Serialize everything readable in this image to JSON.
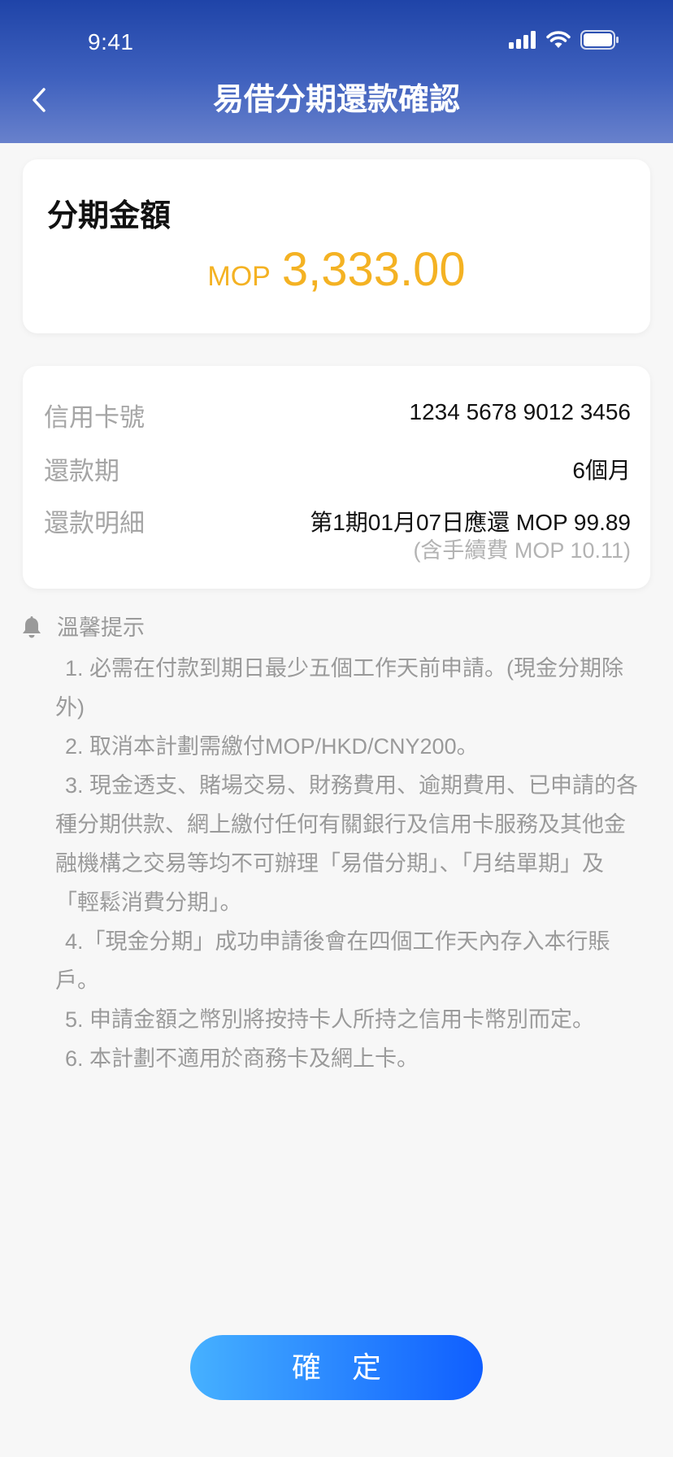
{
  "status_bar": {
    "time": "9:41"
  },
  "header": {
    "title": "易借分期還款確認"
  },
  "amount": {
    "label": "分期金額",
    "currency": "MOP",
    "value": "3,333.00"
  },
  "details": [
    {
      "label": "信用卡號",
      "value": "1234 5678 9012 3456"
    },
    {
      "label": "還款期",
      "value": "6個月"
    },
    {
      "label": "還款明細",
      "value": "第1期01月07日應還 MOP 99.89",
      "sub": "(含手續費 MOP 10.11)"
    }
  ],
  "tips": {
    "title": "溫馨提示",
    "items": [
      "1. 必需在付款到期日最少五個工作天前申請。(現金分期除外)",
      "2. 取消本計劃需繳付MOP/HKD/CNY200。",
      "3. 現金透支、賭場交易、財務費用、逾期費用、已申請的各種分期供款、網上繳付任何有關銀行及信用卡服務及其他金融機構之交易等均不可辦理「易借分期」、「月结單期」及「輕鬆消費分期」。",
      "4.「現金分期」成功申請後會在四個工作天內存入本行賬戶。",
      "5. 申請金額之幣別將按持卡人所持之信用卡幣別而定。",
      "6. 本計劃不適用於商務卡及網上卡。"
    ]
  },
  "confirm_button": {
    "label": "確 定"
  },
  "colors": {
    "header_top": "#1f44a8",
    "header_bottom": "#6881cc",
    "amount": "#f4b223",
    "button_start": "#46b1ff",
    "button_end": "#0f5eff"
  },
  "icons": [
    "signal-icon",
    "wifi-icon",
    "battery-icon",
    "back-chevron-icon",
    "bell-icon"
  ]
}
